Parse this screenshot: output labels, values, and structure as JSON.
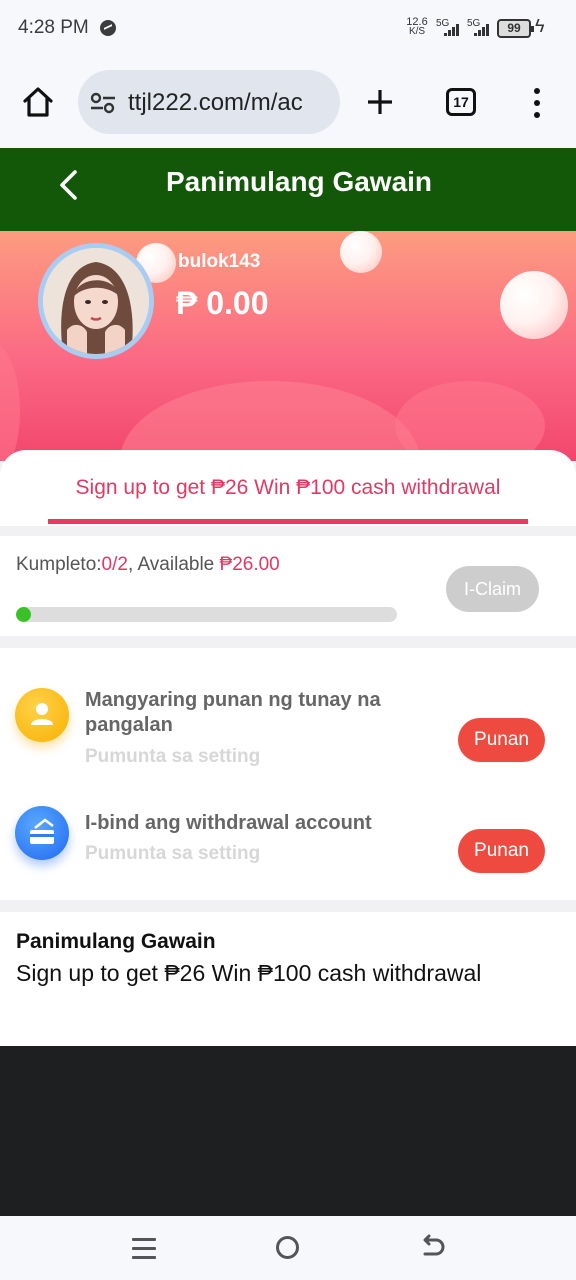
{
  "status_bar": {
    "time": "4:28 PM",
    "speed_value": "12.6",
    "speed_unit": "K/S",
    "net1": "5G",
    "net2": "5G",
    "battery": "99"
  },
  "browser": {
    "url": "ttjl222.com/m/ac",
    "tab_count": "17"
  },
  "header": {
    "title": "Panimulang Gawain"
  },
  "profile": {
    "username": "bulok143",
    "balance": "₱ 0.00"
  },
  "tab": {
    "label": "Sign up to get ₱26  Win ₱100 cash withdrawal"
  },
  "progress": {
    "label_prefix": "Kumpleto:",
    "completed": "0/2",
    "available_prefix": ", Available ",
    "available_amount": "₱26.00",
    "fill_fraction": 0.04,
    "claim_label": "I-Claim"
  },
  "tasks": [
    {
      "title": "Mangyaring punan ng tunay na pangalan",
      "subtitle": "Pumunta sa setting",
      "button": "Punan",
      "icon": "user-icon"
    },
    {
      "title": "I-bind ang withdrawal account",
      "subtitle": "Pumunta sa setting",
      "button": "Punan",
      "icon": "card-icon"
    }
  ],
  "description": {
    "title": "Panimulang Gawain",
    "text": "Sign up to get ₱26 Win ₱100 cash withdrawal"
  },
  "colors": {
    "header_bg": "#135708",
    "accent": "#e03a62",
    "button_red": "#ef4a3f",
    "progress_green": "#38c226"
  }
}
